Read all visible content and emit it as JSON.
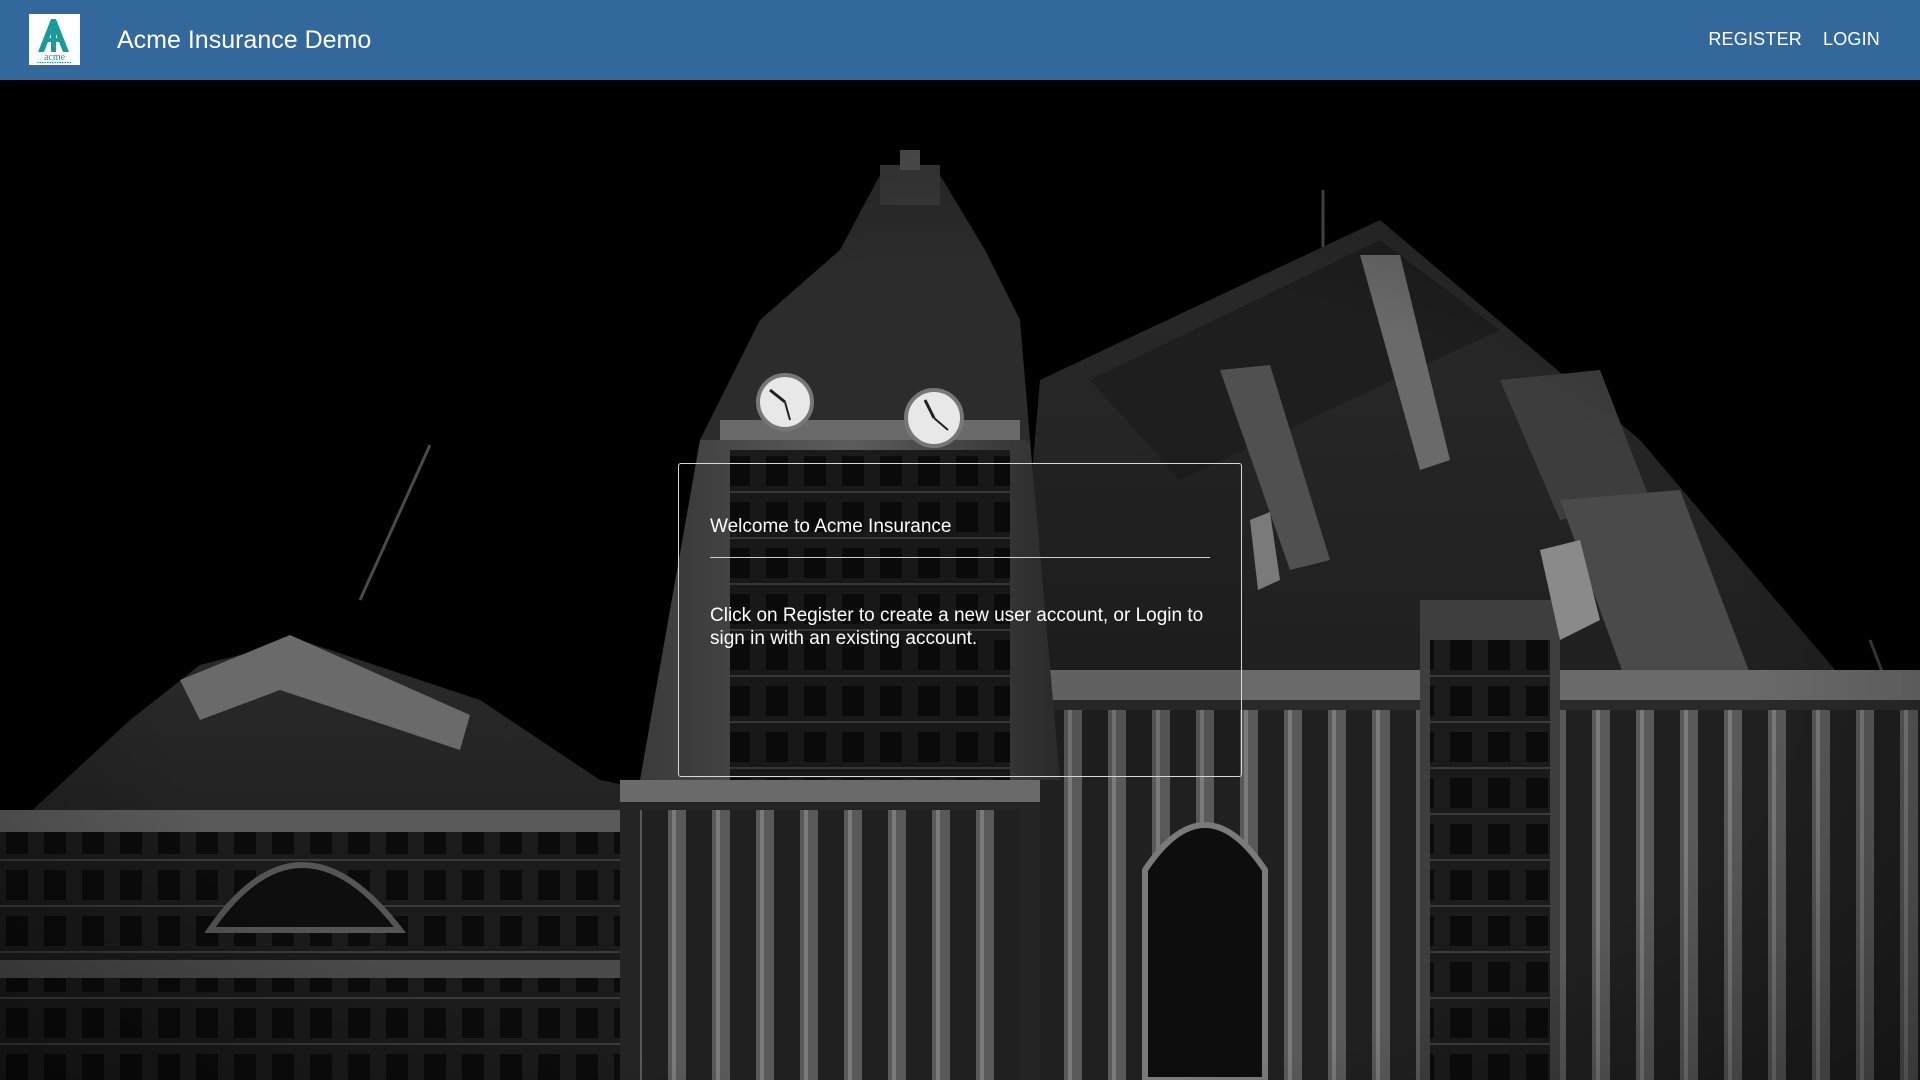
{
  "header": {
    "logo": {
      "icon": "acme-logo",
      "text": "acme",
      "accent": "#1a9a9a"
    },
    "title": "Acme Insurance Demo",
    "nav": [
      {
        "label": "REGISTER"
      },
      {
        "label": "LOGIN"
      }
    ],
    "background_color": "#32689c"
  },
  "hero": {
    "image": "clock-tower-building-night-photo"
  },
  "welcome_card": {
    "title": "Welcome to Acme Insurance",
    "body": "Click on Register to create a new user account, or Login to sign in with an existing account."
  }
}
